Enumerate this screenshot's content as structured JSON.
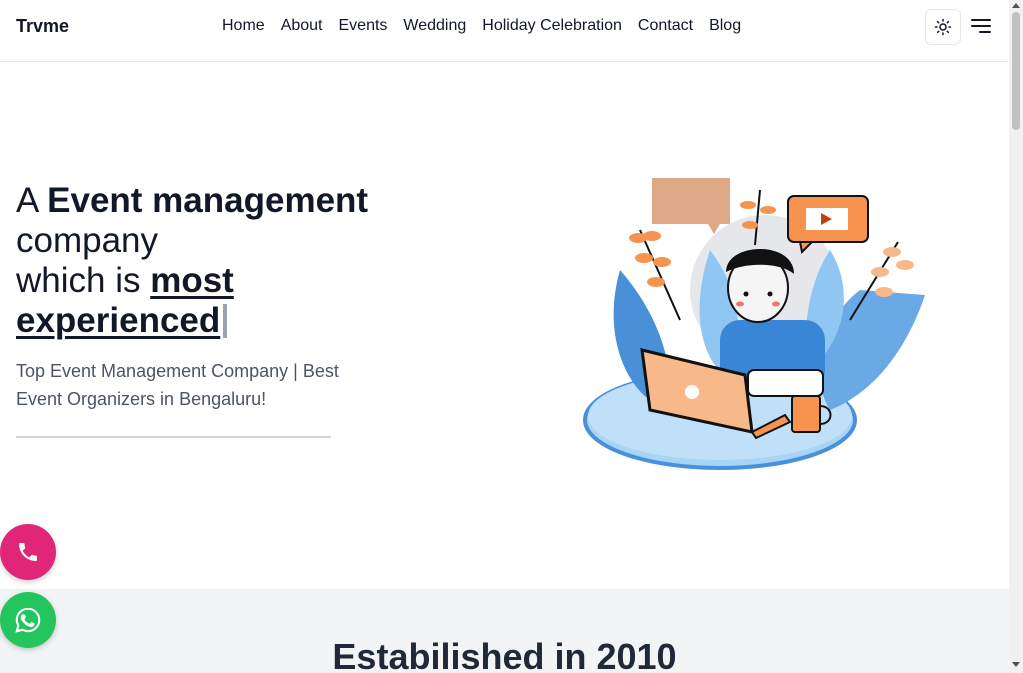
{
  "brand": {
    "name": "Trvme"
  },
  "nav": {
    "items": [
      "Home",
      "About",
      "Events",
      "Wedding",
      "Holiday Celebration",
      "Contact",
      "Blog"
    ]
  },
  "header": {
    "theme_icon": "sun-icon",
    "menu_icon": "menu-icon"
  },
  "hero": {
    "line1_plain": "A ",
    "line1_bold": "Event management",
    "line2": "company",
    "line3_plain": "which is ",
    "line3_underline": "most",
    "line4_underline": "experienced",
    "subtitle": "Top Event Management Company | Best Event Organizers in Bengaluru!"
  },
  "section2": {
    "title": "Estabilished in 2010"
  },
  "floating": {
    "call_icon": "phone-icon",
    "whatsapp_icon": "whatsapp-icon"
  },
  "colors": {
    "call_fab": "#e02777",
    "whatsapp_fab": "#22c55e",
    "illus_orange": "#f6944f",
    "illus_blue": "#4a90d9",
    "illus_light_blue": "#a8d4f5"
  }
}
